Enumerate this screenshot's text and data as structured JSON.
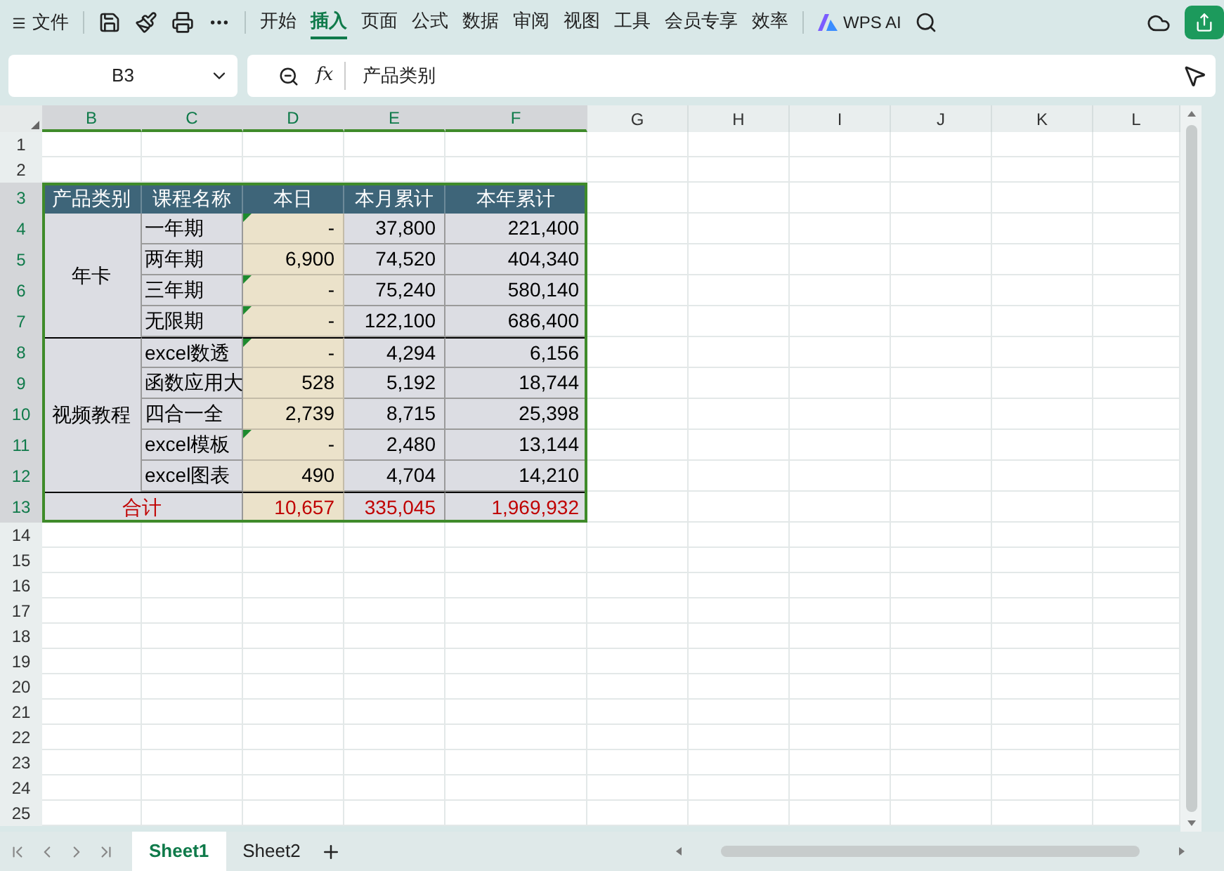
{
  "toolbar": {
    "file_menu": "文件",
    "tabs": [
      {
        "label": "开始",
        "selected": false
      },
      {
        "label": "插入",
        "selected": true
      },
      {
        "label": "页面",
        "selected": false
      },
      {
        "label": "公式",
        "selected": false
      },
      {
        "label": "数据",
        "selected": false
      },
      {
        "label": "审阅",
        "selected": false
      },
      {
        "label": "视图",
        "selected": false
      },
      {
        "label": "工具",
        "selected": false
      },
      {
        "label": "会员专享",
        "selected": false
      },
      {
        "label": "效率",
        "selected": false
      }
    ],
    "ai_button": "WPS AI"
  },
  "formula_bar": {
    "cell_ref": "B3",
    "fx": "fx",
    "value": "产品类别"
  },
  "grid": {
    "columns": [
      {
        "label": "B",
        "selected": true
      },
      {
        "label": "C",
        "selected": true
      },
      {
        "label": "D",
        "selected": true
      },
      {
        "label": "E",
        "selected": true
      },
      {
        "label": "F",
        "selected": true
      },
      {
        "label": "G",
        "selected": false
      },
      {
        "label": "H",
        "selected": false
      },
      {
        "label": "I",
        "selected": false
      },
      {
        "label": "J",
        "selected": false
      },
      {
        "label": "K",
        "selected": false
      },
      {
        "label": "L",
        "selected": false
      }
    ],
    "rows": [
      {
        "label": "1",
        "selected": false
      },
      {
        "label": "2",
        "selected": false
      },
      {
        "label": "3",
        "selected": true
      },
      {
        "label": "4",
        "selected": true
      },
      {
        "label": "5",
        "selected": true
      },
      {
        "label": "6",
        "selected": true
      },
      {
        "label": "7",
        "selected": true
      },
      {
        "label": "8",
        "selected": true
      },
      {
        "label": "9",
        "selected": true
      },
      {
        "label": "10",
        "selected": true
      },
      {
        "label": "11",
        "selected": true
      },
      {
        "label": "12",
        "selected": true
      },
      {
        "label": "13",
        "selected": true
      },
      {
        "label": "14",
        "selected": false
      },
      {
        "label": "15",
        "selected": false
      },
      {
        "label": "16",
        "selected": false
      },
      {
        "label": "17",
        "selected": false
      },
      {
        "label": "18",
        "selected": false
      },
      {
        "label": "19",
        "selected": false
      },
      {
        "label": "20",
        "selected": false
      },
      {
        "label": "21",
        "selected": false
      },
      {
        "label": "22",
        "selected": false
      },
      {
        "label": "23",
        "selected": false
      },
      {
        "label": "24",
        "selected": false
      },
      {
        "label": "25",
        "selected": false
      }
    ]
  },
  "table": {
    "header": [
      "产品类别",
      "课程名称",
      "本日",
      "本月累计",
      "本年累计"
    ],
    "groups": [
      {
        "category": "年卡",
        "rows": [
          {
            "course": "一年期",
            "day": "-",
            "month": "37,800",
            "year": "221,400",
            "flagged": true
          },
          {
            "course": "两年期",
            "day": "6,900",
            "month": "74,520",
            "year": "404,340",
            "flagged": false
          },
          {
            "course": "三年期",
            "day": "-",
            "month": "75,240",
            "year": "580,140",
            "flagged": true
          },
          {
            "course": "无限期",
            "day": "-",
            "month": "122,100",
            "year": "686,400",
            "flagged": true
          }
        ]
      },
      {
        "category": "视频教程",
        "rows": [
          {
            "course": "excel数透",
            "day": "-",
            "month": "4,294",
            "year": "6,156",
            "flagged": true
          },
          {
            "course": "函数应用大",
            "day": "528",
            "month": "5,192",
            "year": "18,744",
            "flagged": false
          },
          {
            "course": "四合一全",
            "day": "2,739",
            "month": "8,715",
            "year": "25,398",
            "flagged": false
          },
          {
            "course": "excel模板",
            "day": "-",
            "month": "2,480",
            "year": "13,144",
            "flagged": true
          },
          {
            "course": "excel图表",
            "day": "490",
            "month": "4,704",
            "year": "14,210",
            "flagged": false
          }
        ]
      }
    ],
    "total": {
      "label": "合计",
      "day": "10,657",
      "month": "335,045",
      "year": "1,969,932"
    }
  },
  "sheet_tabs": [
    {
      "label": "Sheet1",
      "selected": true
    },
    {
      "label": "Sheet2",
      "selected": false
    }
  ]
}
